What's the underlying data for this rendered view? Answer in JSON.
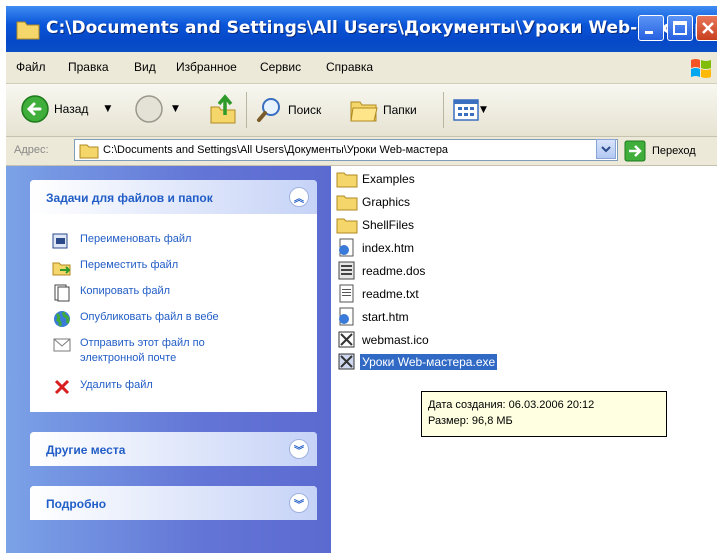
{
  "window": {
    "title": "C:\\Documents and Settings\\All Users\\Документы\\Уроки Web-мастера"
  },
  "menu": [
    "Файл",
    "Правка",
    "Вид",
    "Избранное",
    "Сервис",
    "Справка"
  ],
  "toolbar": {
    "back_label": "Назад",
    "search_label": "Поиск",
    "folders_label": "Папки"
  },
  "address": {
    "label": "Адрес:",
    "value": "C:\\Documents and Settings\\All Users\\Документы\\Уроки Web-мастера",
    "go_label": "Переход"
  },
  "tasks_panel": {
    "title": "Задачи для файлов и папок",
    "items": [
      {
        "label": "Переименовать файл",
        "icon": "rename-icon"
      },
      {
        "label": "Переместить файл",
        "icon": "move-icon"
      },
      {
        "label": "Копировать файл",
        "icon": "copy-icon"
      },
      {
        "label": "Опубликовать файл в вебе",
        "icon": "globe-icon"
      },
      {
        "label": "Отправить этот файл по электронной почте",
        "icon": "mail-icon"
      },
      {
        "label": "Удалить файл",
        "icon": "delete-icon"
      }
    ]
  },
  "other_places": {
    "title": "Другие места"
  },
  "details": {
    "title": "Подробно"
  },
  "files": [
    {
      "name": "Examples",
      "type": "folder"
    },
    {
      "name": "Graphics",
      "type": "folder"
    },
    {
      "name": "ShellFiles",
      "type": "folder"
    },
    {
      "name": "index.htm",
      "type": "html"
    },
    {
      "name": "readme.dos",
      "type": "doc"
    },
    {
      "name": "readme.txt",
      "type": "txt"
    },
    {
      "name": "start.htm",
      "type": "html"
    },
    {
      "name": "webmast.ico",
      "type": "ico"
    },
    {
      "name": "Уроки Web-мастера.exe",
      "type": "exe",
      "selected": true
    }
  ],
  "tooltip": {
    "line1": "Дата создания: 06.03.2006 20:12",
    "line2": "Размер: 96,8 МБ"
  },
  "colors": {
    "titlebar": "#0a55d9",
    "task_link": "#215dc6",
    "selection": "#316ac5",
    "tooltip_bg": "#ffffe1"
  }
}
